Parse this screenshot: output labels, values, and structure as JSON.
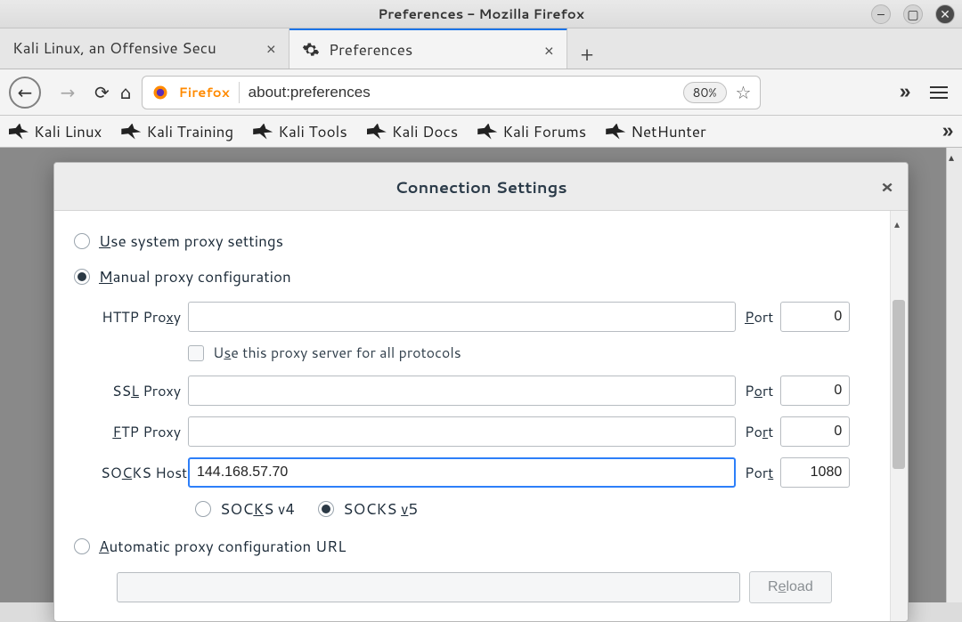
{
  "window": {
    "title": "Preferences - Mozilla Firefox"
  },
  "tabs": {
    "inactive": "Kali Linux, an Offensive Secu",
    "active": "Preferences"
  },
  "urlbar": {
    "identity": "Firefox",
    "value": "about:preferences",
    "zoom": "80%"
  },
  "bookmarks": [
    "Kali Linux",
    "Kali Training",
    "Kali Tools",
    "Kali Docs",
    "Kali Forums",
    "NetHunter"
  ],
  "dialog": {
    "title": "Connection Settings",
    "use_system": "Use system proxy settings",
    "manual": "Manual proxy configuration",
    "http_label": "HTTP Proxy",
    "http_value": "",
    "http_port": "0",
    "use_all": "Use this proxy server for all protocols",
    "ssl_label": "SSL Proxy",
    "ssl_value": "",
    "ssl_port": "0",
    "ftp_label": "FTP Proxy",
    "ftp_value": "",
    "ftp_port": "0",
    "socks_label": "SOCKS Host",
    "socks_value": "144.168.57.70",
    "socks_port": "1080",
    "socks_v4": "SOCKS v4",
    "socks_v5": "SOCKS v5",
    "auto": "Automatic proxy configuration URL",
    "reload": "Reload",
    "port": "Port"
  }
}
